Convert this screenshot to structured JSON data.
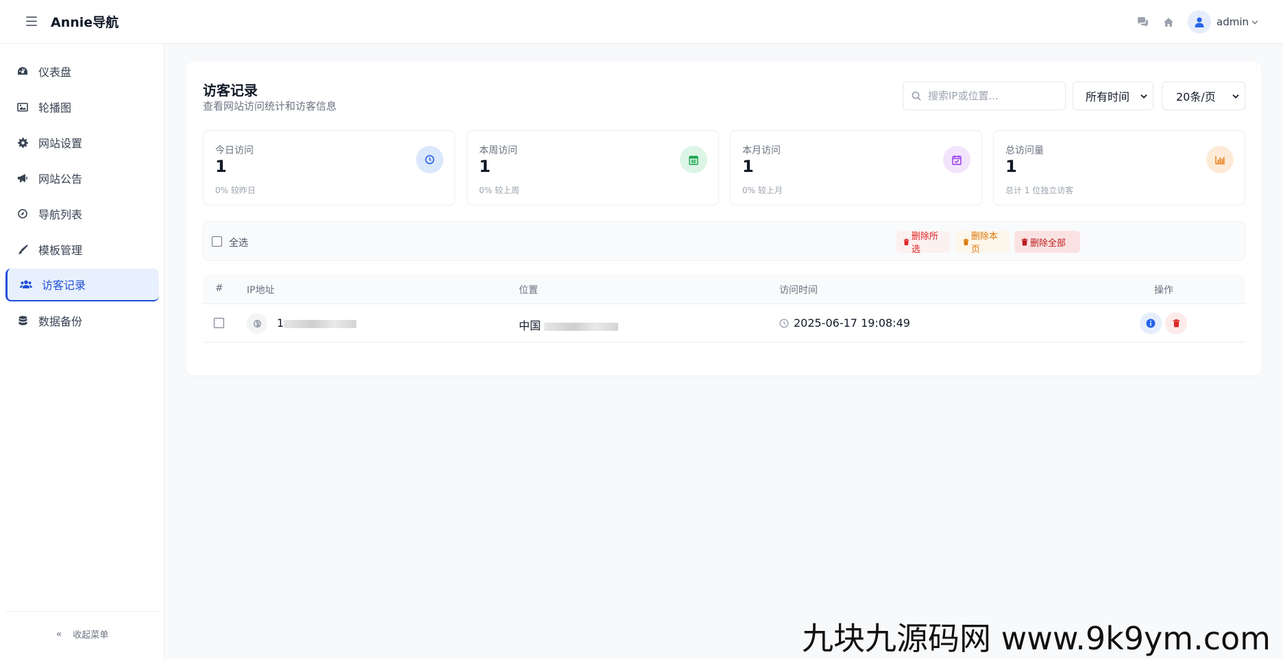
{
  "header": {
    "brand": "Annie导航",
    "user": "admin",
    "icons": [
      "chat-icon",
      "home-icon",
      "user-icon"
    ]
  },
  "sidebar": {
    "items": [
      {
        "label": "仪表盘",
        "icon": "dashboard-icon"
      },
      {
        "label": "轮播图",
        "icon": "image-icon"
      },
      {
        "label": "网站设置",
        "icon": "gear-icon"
      },
      {
        "label": "网站公告",
        "icon": "megaphone-icon"
      },
      {
        "label": "导航列表",
        "icon": "compass-icon"
      },
      {
        "label": "模板管理",
        "icon": "brush-icon"
      },
      {
        "label": "访客记录",
        "icon": "users-icon",
        "active": true
      },
      {
        "label": "数据备份",
        "icon": "database-icon"
      }
    ],
    "collapse_label": "收起菜单"
  },
  "main": {
    "title": "访客记录",
    "subtitle": "查看网站访问统计和访客信息",
    "search_placeholder": "搜索IP或位置...",
    "time_filter": "所有时间",
    "page_size": "20条/页",
    "stats": [
      {
        "label": "今日访问",
        "value": "1",
        "note": "0% 较昨日",
        "icon": "clock-icon",
        "color": "#2563eb",
        "bg": "#dbe7fb"
      },
      {
        "label": "本周访问",
        "value": "1",
        "note": "0% 较上周",
        "icon": "calendar-icon",
        "color": "#16a34a",
        "bg": "#dcf5e6"
      },
      {
        "label": "本月访问",
        "value": "1",
        "note": "0% 较上月",
        "icon": "calendar-check-icon",
        "color": "#9333ea",
        "bg": "#f1e4fb"
      },
      {
        "label": "总访问量",
        "value": "1",
        "note": "总计 1 位独立访客",
        "icon": "bar-chart-icon",
        "color": "#ea7a12",
        "bg": "#fdebd8"
      }
    ],
    "toolbar": {
      "select_all": "全选",
      "delete_selected": "删除所选",
      "delete_page": "删除本页",
      "delete_all": "删除全部"
    },
    "table": {
      "headers": [
        "#",
        "IP地址",
        "位置",
        "访问时间",
        "操作"
      ],
      "rows": [
        {
          "ip_prefix": "1",
          "location_prefix": "中国",
          "time": "2025-06-17 19:08:49"
        }
      ]
    }
  },
  "watermark": "九块九源码网 www.9k9ym.com"
}
